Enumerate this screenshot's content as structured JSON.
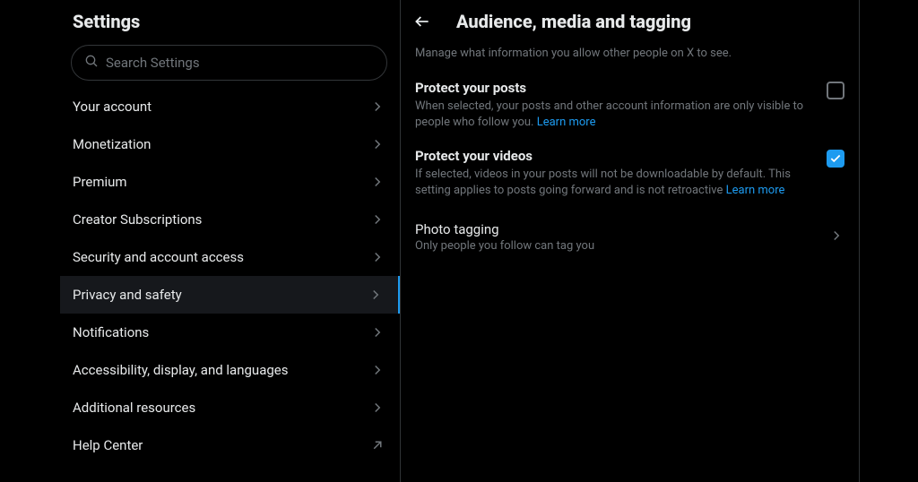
{
  "sidebar": {
    "title": "Settings",
    "search_placeholder": "Search Settings",
    "items": [
      {
        "label": "Your account"
      },
      {
        "label": "Monetization"
      },
      {
        "label": "Premium"
      },
      {
        "label": "Creator Subscriptions"
      },
      {
        "label": "Security and account access"
      },
      {
        "label": "Privacy and safety"
      },
      {
        "label": "Notifications"
      },
      {
        "label": "Accessibility, display, and languages"
      },
      {
        "label": "Additional resources"
      },
      {
        "label": "Help Center"
      }
    ]
  },
  "detail": {
    "title": "Audience, media and tagging",
    "subtitle": "Manage what information you allow other people on X to see.",
    "protect_posts": {
      "title": "Protect your posts",
      "desc": "When selected, your posts and other account information are only visible to people who follow you. ",
      "learn_more": "Learn more"
    },
    "protect_videos": {
      "title": "Protect your videos",
      "desc": "If selected, videos in your posts will not be downloadable by default. This setting applies to posts going forward and is not retroactive ",
      "learn_more": "Learn more"
    },
    "photo_tagging": {
      "title": "Photo tagging",
      "subtitle": "Only people you follow can tag you"
    }
  }
}
